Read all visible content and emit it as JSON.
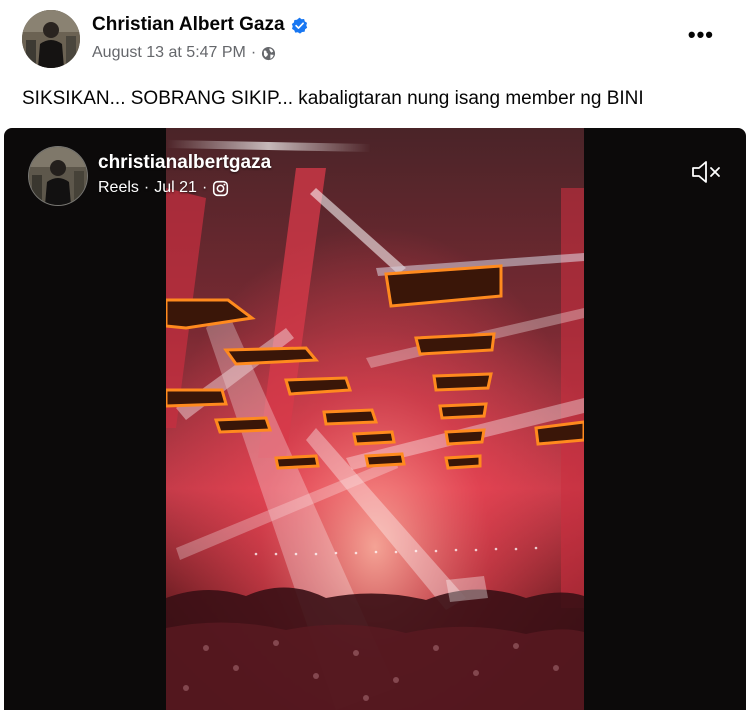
{
  "post": {
    "author": "Christian Albert Gaza",
    "date": "August 13 at 5:47 PM",
    "separator": "·",
    "caption": "SIKSIKAN... SOBRANG SIKIP... kabaligtaran nung isang member ng BINI",
    "more": "•••"
  },
  "reel": {
    "username": "christianalbertgaza",
    "source": "Reels",
    "separator": "·",
    "date": "Jul 21",
    "separator2": "·"
  },
  "colors": {
    "verified": "#1877f2",
    "meta_text": "#65676b",
    "stage_red": "#e8334a",
    "stage_orange": "#ff8a1e"
  }
}
